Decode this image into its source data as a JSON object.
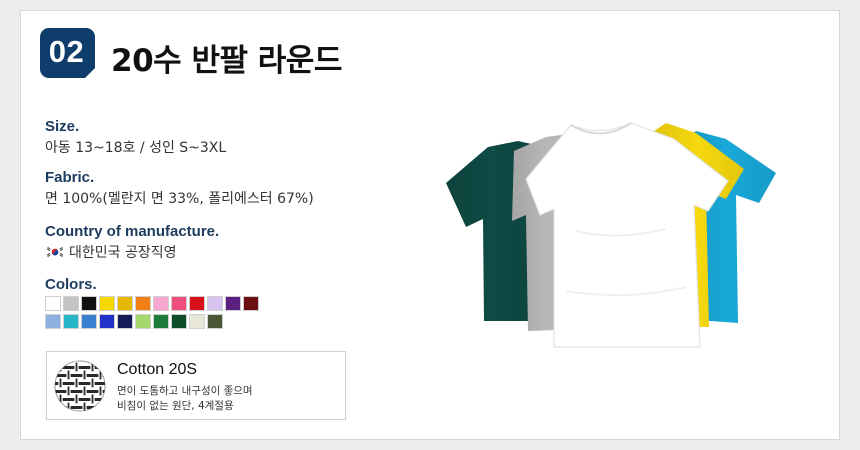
{
  "header": {
    "number": "02",
    "title": "20수 반팔 라운드"
  },
  "specs": {
    "size": {
      "label": "Size.",
      "value": "아동 13~18호 / 성인 S~3XL"
    },
    "fabric": {
      "label": "Fabric.",
      "value": "면 100%(멜란지 면 33%, 폴리에스터 67%)"
    },
    "country": {
      "label": "Country of manufacture.",
      "value": "대한민국 공장직영",
      "flag_icon": "korea-flag-icon"
    },
    "colors": {
      "label": "Colors."
    }
  },
  "color_swatches": {
    "row1": [
      "#ffffff",
      "#c4c4c4",
      "#111111",
      "#f5d800",
      "#e6b800",
      "#f07f14",
      "#f6a6cf",
      "#ef4f7c",
      "#d8101a",
      "#d7c4ee",
      "#5b2080",
      "#6c0f12"
    ],
    "row2": [
      "#8cb0e0",
      "#25b7c7",
      "#3b7fd0",
      "#2131c8",
      "#151c58",
      "#a5d86c",
      "#1c7a3b",
      "#0e4d2a",
      "#e8e6d8",
      "#4b5636"
    ]
  },
  "cotton": {
    "icon": "woven-fabric-icon",
    "title": "Cotton 20S",
    "desc_line1": "면이 도톰하고 내구성이 좋으며",
    "desc_line2": "비침이 없는 원단, 4계절용"
  },
  "product_image": {
    "icon": "tshirt-stack-image",
    "colors": [
      "#0f4a44",
      "#b8b8b8",
      "#ffffff",
      "#f6d80e",
      "#18a8d8"
    ]
  }
}
